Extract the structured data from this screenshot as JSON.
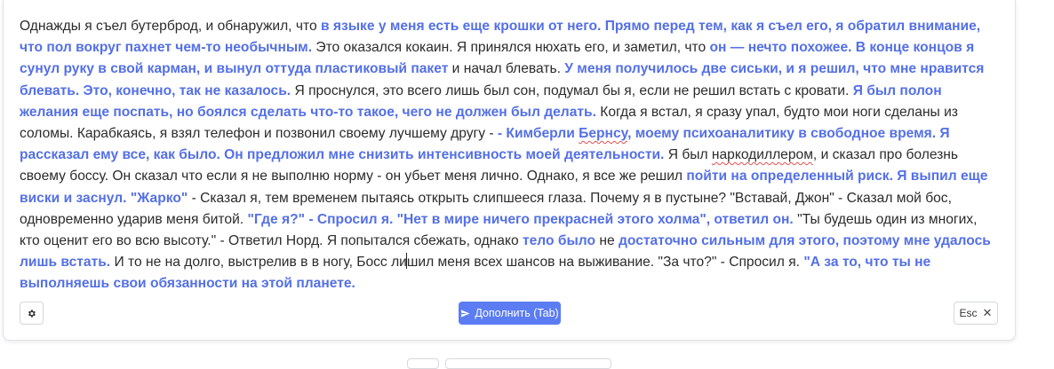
{
  "story": {
    "segments": [
      {
        "t": "Однажды я съел бутерброд, и обнаружил, что ",
        "ai": false
      },
      {
        "t": "в языке у меня есть еще крошки от него. Прямо перед тем, как я съел его, я обратил внимание, что пол вокруг пахнет чем-то необычным.",
        "ai": true
      },
      {
        "t": " Это оказался кокаин. Я принялся нюхать его, и заметил, что ",
        "ai": false
      },
      {
        "t": "он — нечто похожее. В конце концов я сунул руку в свой карман, и вынул оттуда пластиковый пакет",
        "ai": true
      },
      {
        "t": " и начал блевать. ",
        "ai": false
      },
      {
        "t": "У меня получилось две сиськи, и я решил, что мне нравится блевать. Это, конечно, так не казалось.",
        "ai": true
      },
      {
        "t": " Я проснулся, это всего лишь был сон, подумал бы я, если не решил встать с кровати. ",
        "ai": false
      },
      {
        "t": "Я был полон желания еще поспать, но боялся сделать что-то такое, чего не должен был делать.",
        "ai": true
      },
      {
        "t": " Когда я встал, я сразу упал, будто мои ноги сделаны из соломы. Карабкаясь, я взял телефон и позвонил своему лучшему другу -  ",
        "ai": false
      },
      {
        "t": " - Кимберли ",
        "ai": true
      },
      {
        "t": "Бернсу",
        "ai": true,
        "spell": true
      },
      {
        "t": ", моему психоаналитику в свободное время. Я рассказал ему все, как было. Он предложил мне снизить интенсивность моей деятельности.",
        "ai": true
      },
      {
        "t": " Я был ",
        "ai": false
      },
      {
        "t": "наркодиллером",
        "ai": false,
        "spell": true
      },
      {
        "t": ", и сказал про болезнь своему боссу. Он сказал что если я не выполню норму - он убьет меня лично. Однако, я все же решил ",
        "ai": false
      },
      {
        "t": "пойти на определенный риск. Я выпил еще виски и заснул.",
        "ai": true
      },
      {
        "t": " ",
        "ai": false
      },
      {
        "t": "\"Жарко\"",
        "ai": true
      },
      {
        "t": " - Сказал я, тем временем пытаясь открыть слипшееся глаза. Почему я в пустыне? \"Вставай, Джон\" - Сказал мой бос, одновременно ударив меня битой. ",
        "ai": false
      },
      {
        "t": "\"Где я?\" - Спросил я. \"Нет в мире ничего прекрасней этого холма\", ответил он.",
        "ai": true
      },
      {
        "t": " \"Ты будешь один из многих, кто оценит его во всю высоту.\" - Ответил Норд. Я попытался сбежать, однако ",
        "ai": false
      },
      {
        "t": "тело было",
        "ai": true
      },
      {
        "t": " не ",
        "ai": false
      },
      {
        "t": "достаточно сильным для этого, поэтому мне удалось лишь встать.",
        "ai": true
      },
      {
        "t": " И то не на долго, выстрелив в в ногу, Босс ли",
        "ai": false
      },
      {
        "t": "|CURSOR|",
        "ai": false
      },
      {
        "t": "шил меня всех шансов на выживание. \"За что?\" - Спросил я. ",
        "ai": false
      },
      {
        "t": "\"А за то, что ты не выполняешь свои обязанности на этой планете.",
        "ai": true
      }
    ]
  },
  "toolbar": {
    "settings_icon": "gear-icon",
    "continue_label": "Дополнить (Tab)",
    "continue_icon": "send-icon",
    "esc_label": "Esc",
    "esc_icon": "close-icon"
  },
  "colors": {
    "ai_text": "#5470e6",
    "primary_button": "#5b7cf2"
  }
}
